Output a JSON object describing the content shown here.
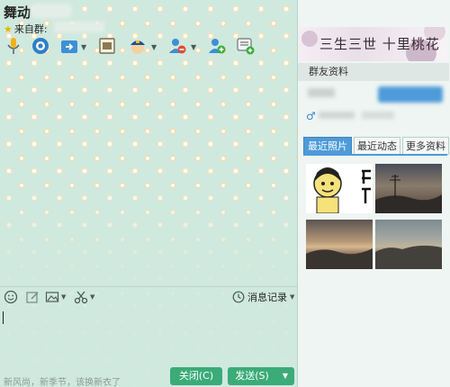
{
  "window": {
    "title": "舞动",
    "group_label": "来自群:",
    "controls": [
      "▾",
      "—",
      "☐",
      "✕"
    ]
  },
  "toolbar": {
    "icons": [
      "voice-icon",
      "video-icon",
      "file-transfer-icon",
      "app-window-icon",
      "police-icon",
      "remove-user-icon",
      "add-user-icon",
      "group-message-icon"
    ]
  },
  "right_panel": {
    "banner_text": "三生三世 十里桃花",
    "section_title": "群友资料",
    "tabs": [
      "最近照片",
      "最近动态",
      "更多资料"
    ],
    "active_tab": "最近照片"
  },
  "input_toolbar": {
    "icons": [
      "emoji-icon",
      "edit-icon",
      "image-icon",
      "scissors-icon"
    ],
    "history_label": "消息记录"
  },
  "footer": {
    "tip_text": "新风尚，新季节，该换新衣了",
    "close_button": "关闭(C)",
    "send_button": "发送(S)"
  },
  "colors": {
    "accent": "#4d9bd8",
    "button_green": "#3bab78",
    "chat_bg": "#cfe9df"
  }
}
